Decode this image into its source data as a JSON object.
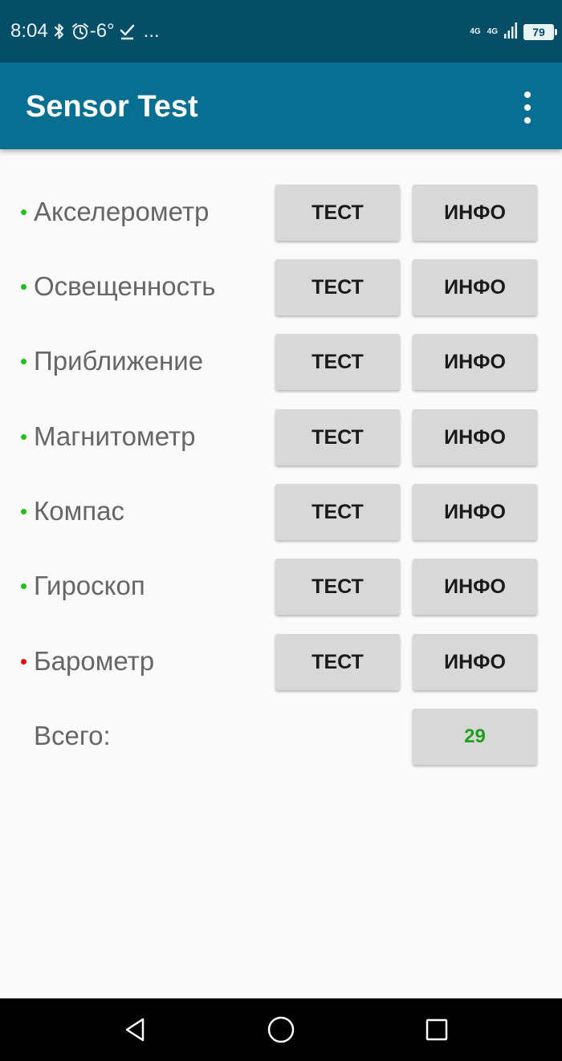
{
  "status_bar": {
    "time": "8:04",
    "temperature": "-6°",
    "more": "...",
    "network_1": "4G",
    "network_2": "4G",
    "battery": "79",
    "icons": [
      "bluetooth-icon",
      "alarm-icon",
      "check-icon",
      "signal-icon"
    ]
  },
  "app_bar": {
    "title": "Sensor Test",
    "menu_icon": "overflow-menu-icon"
  },
  "sensors": [
    {
      "name": "Акселерометр",
      "status_color": "#1fbf1f",
      "test_label": "ТЕСТ",
      "info_label": "ИНФО"
    },
    {
      "name": "Освещенность",
      "status_color": "#1fbf1f",
      "test_label": "ТЕСТ",
      "info_label": "ИНФО"
    },
    {
      "name": "Приближение",
      "status_color": "#1fbf1f",
      "test_label": "ТЕСТ",
      "info_label": "ИНФО"
    },
    {
      "name": "Магнитометр",
      "status_color": "#1fbf1f",
      "test_label": "ТЕСТ",
      "info_label": "ИНФО"
    },
    {
      "name": "Компас",
      "status_color": "#1fbf1f",
      "test_label": "ТЕСТ",
      "info_label": "ИНФО"
    },
    {
      "name": "Гироскоп",
      "status_color": "#1fbf1f",
      "test_label": "ТЕСТ",
      "info_label": "ИНФО"
    },
    {
      "name": "Барометр",
      "status_color": "#e01010",
      "test_label": "ТЕСТ",
      "info_label": "ИНФО"
    }
  ],
  "total": {
    "label": "Всего:",
    "value": "29",
    "value_color": "#1e9e1e"
  },
  "nav_bar": {
    "icons": [
      "back-icon",
      "home-icon",
      "recents-icon"
    ]
  },
  "colors": {
    "status_bar": "#044e67",
    "app_bar": "#076f91",
    "background": "#fafafa",
    "button": "#d8d8d8"
  }
}
